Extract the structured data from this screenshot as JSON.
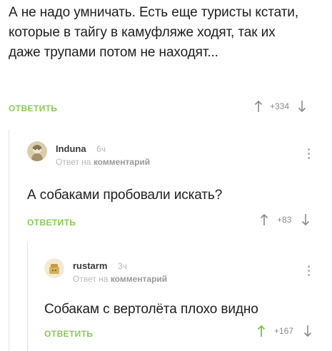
{
  "comments": [
    {
      "text": "А не надо умничать. Есть еще туристы кстати, которые в тайгу в камуфляже ходят, так их даже трупами потом не находят...",
      "reply_label": "ОТВЕТИТЬ",
      "rating": "+334"
    },
    {
      "author": "Induna",
      "time": "6ч",
      "reply_to_prefix": "Ответ на",
      "reply_to_link": "комментарий",
      "text": "А собаками пробовали искать?",
      "reply_label": "ОТВЕТИТЬ",
      "rating": "+83"
    },
    {
      "author": "rustarm",
      "time": "3ч",
      "reply_to_prefix": "Ответ на",
      "reply_to_link": "комментарий",
      "text": "Собакам с вертолёта плохо видно",
      "reply_label": "ОТВЕТИТЬ",
      "rating": "+167"
    }
  ],
  "icons": {
    "upvote": "arrow-up-icon",
    "downvote": "arrow-down-icon",
    "more": "more-vertical-icon"
  },
  "colors": {
    "reply": "#8ac858",
    "vote": "#9b9b9b",
    "thread_line": "#e2e2e2"
  }
}
